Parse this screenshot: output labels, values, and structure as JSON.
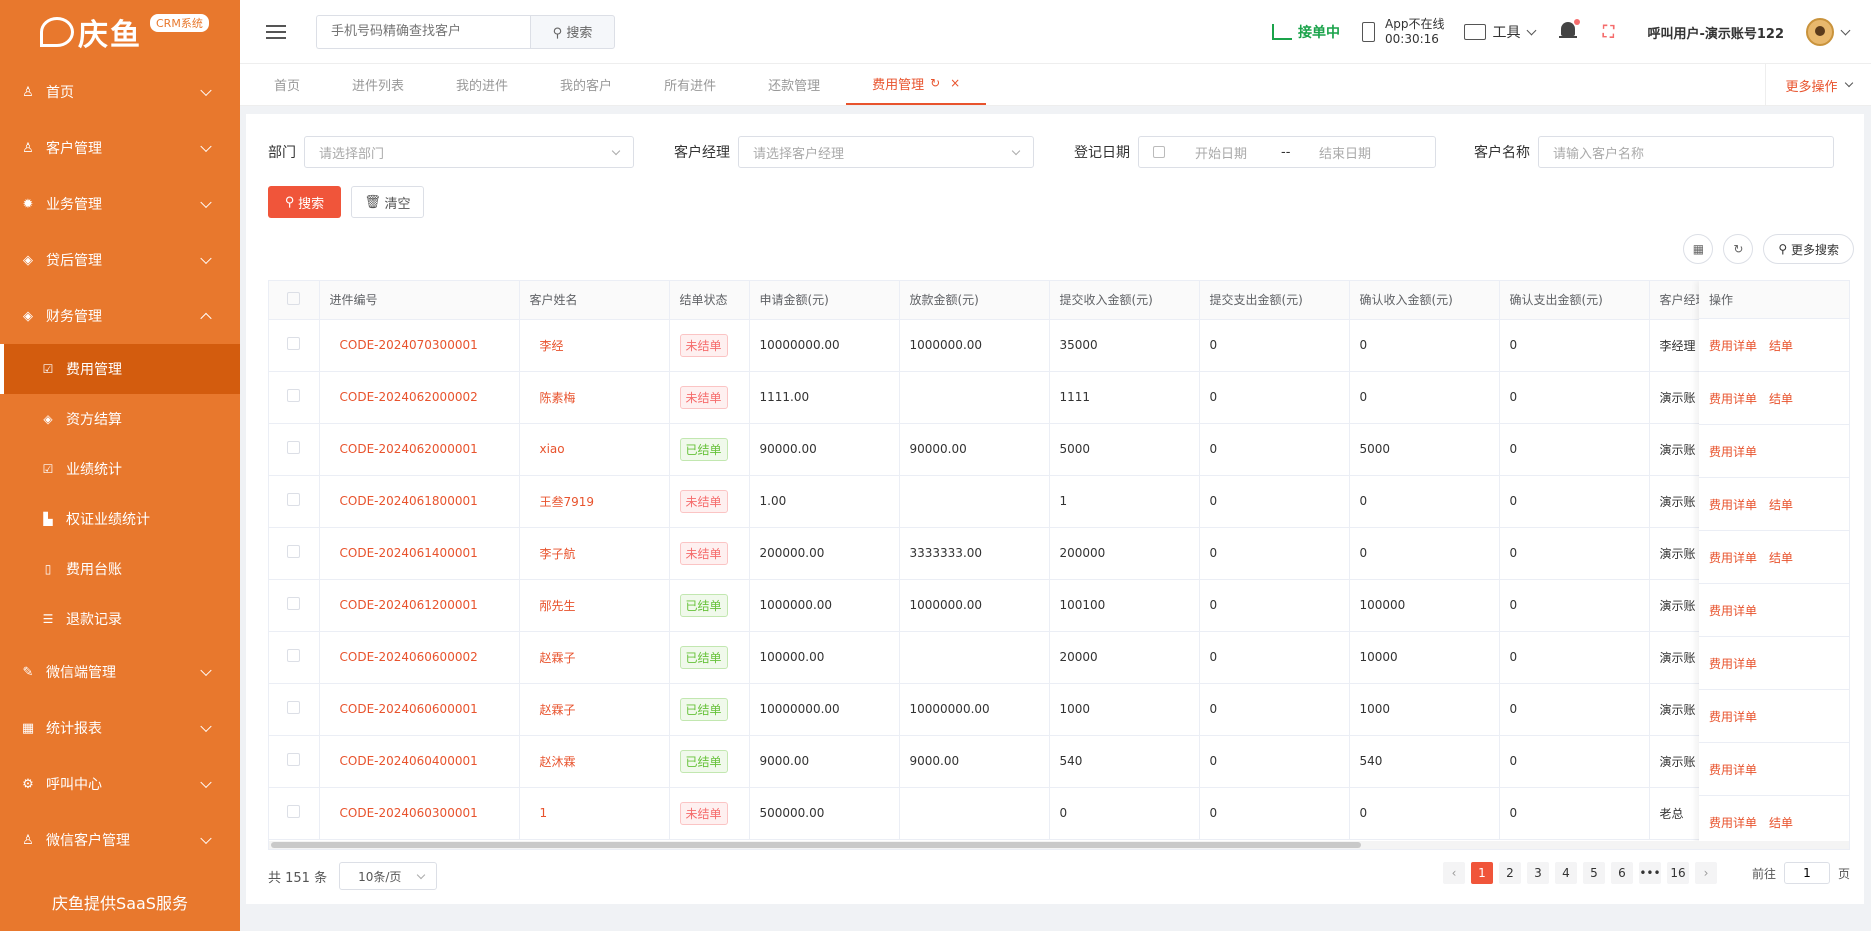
{
  "brand": {
    "name": "庆鱼",
    "badge": "CRM系统"
  },
  "sidebar": {
    "items": [
      {
        "label": "首页",
        "icon": "user-icon",
        "glyph": "♙"
      },
      {
        "label": "客户管理",
        "icon": "customer-icon",
        "glyph": "♙"
      },
      {
        "label": "业务管理",
        "icon": "bug-icon",
        "glyph": "✹"
      },
      {
        "label": "贷后管理",
        "icon": "tag-icon",
        "glyph": "◈"
      },
      {
        "label": "财务管理",
        "icon": "tag-icon",
        "glyph": "◈"
      }
    ],
    "sub_items": [
      {
        "label": "费用管理",
        "icon": "check-square-icon",
        "glyph": "☑"
      },
      {
        "label": "资方结算",
        "icon": "tag-icon",
        "glyph": "◈"
      },
      {
        "label": "业绩统计",
        "icon": "check-square-icon",
        "glyph": "☑"
      },
      {
        "label": "权证业绩统计",
        "icon": "bar-chart-icon",
        "glyph": "▙"
      },
      {
        "label": "费用台账",
        "icon": "book-icon",
        "glyph": "▯"
      },
      {
        "label": "退款记录",
        "icon": "list-icon",
        "glyph": "☰"
      }
    ],
    "items_after": [
      {
        "label": "微信端管理",
        "icon": "edit-icon",
        "glyph": "✎"
      },
      {
        "label": "统计报表",
        "icon": "table-icon",
        "glyph": "▦"
      },
      {
        "label": "呼叫中心",
        "icon": "settings-icon",
        "glyph": "⚙"
      },
      {
        "label": "微信客户管理",
        "icon": "customer-icon",
        "glyph": "♙"
      }
    ],
    "footer": "庆鱼提供SaaS服务"
  },
  "header": {
    "search_placeholder": "手机号码精确查找客户",
    "search_button": "搜索",
    "accept_label": "接单中",
    "app_status": "App不在线",
    "app_time": "00:30:16",
    "tools_label": "工具",
    "username": "呼叫用户-演示账号122"
  },
  "tabs": [
    {
      "label": "首页"
    },
    {
      "label": "进件列表"
    },
    {
      "label": "我的进件"
    },
    {
      "label": "我的客户"
    },
    {
      "label": "所有进件"
    },
    {
      "label": "还款管理"
    },
    {
      "label": "费用管理"
    }
  ],
  "more_ops": "更多操作",
  "filters": {
    "dept_label": "部门",
    "dept_placeholder": "请选择部门",
    "manager_label": "客户经理",
    "manager_placeholder": "请选择客户经理",
    "date_label": "登记日期",
    "date_start": "开始日期",
    "date_sep": "--",
    "date_end": "结束日期",
    "name_label": "客户名称",
    "name_placeholder": "请输入客户名称",
    "search_btn": "搜索",
    "clear_btn": "清空",
    "more_search": "更多搜索"
  },
  "table": {
    "columns": [
      "进件编号",
      "客户姓名",
      "结单状态",
      "申请金额(元)",
      "放款金额(元)",
      "提交收入金额(元)",
      "提交支出金额(元)",
      "确认收入金额(元)",
      "确认支出金额(元)",
      "客户经理",
      "操作"
    ],
    "rows": [
      {
        "code": "CODE-2024070300001",
        "name": "李经",
        "status": "未结单",
        "closed": false,
        "apply": "10000000.00",
        "loan": "1000000.00",
        "sub_in": "35000",
        "sub_out": "0",
        "conf_in": "0",
        "conf_out": "0",
        "manager": "李经理"
      },
      {
        "code": "CODE-2024062000002",
        "name": "陈素梅",
        "status": "未结单",
        "closed": false,
        "apply": "1111.00",
        "loan": "",
        "sub_in": "1111",
        "sub_out": "0",
        "conf_in": "0",
        "conf_out": "0",
        "manager": "演示账"
      },
      {
        "code": "CODE-2024062000001",
        "name": "xiao",
        "status": "已结单",
        "closed": true,
        "apply": "90000.00",
        "loan": "90000.00",
        "sub_in": "5000",
        "sub_out": "0",
        "conf_in": "5000",
        "conf_out": "0",
        "manager": "演示账"
      },
      {
        "code": "CODE-2024061800001",
        "name": "王叁7919",
        "status": "未结单",
        "closed": false,
        "apply": "1.00",
        "loan": "",
        "sub_in": "1",
        "sub_out": "0",
        "conf_in": "0",
        "conf_out": "0",
        "manager": "演示账"
      },
      {
        "code": "CODE-2024061400001",
        "name": "李子航",
        "status": "未结单",
        "closed": false,
        "apply": "200000.00",
        "loan": "3333333.00",
        "sub_in": "200000",
        "sub_out": "0",
        "conf_in": "0",
        "conf_out": "0",
        "manager": "演示账"
      },
      {
        "code": "CODE-2024061200001",
        "name": "邴先生",
        "status": "已结单",
        "closed": true,
        "apply": "1000000.00",
        "loan": "1000000.00",
        "sub_in": "100100",
        "sub_out": "0",
        "conf_in": "100000",
        "conf_out": "0",
        "manager": "演示账"
      },
      {
        "code": "CODE-2024060600002",
        "name": "赵霖子",
        "status": "已结单",
        "closed": true,
        "apply": "100000.00",
        "loan": "",
        "sub_in": "20000",
        "sub_out": "0",
        "conf_in": "10000",
        "conf_out": "0",
        "manager": "演示账"
      },
      {
        "code": "CODE-2024060600001",
        "name": "赵霖子",
        "status": "已结单",
        "closed": true,
        "apply": "10000000.00",
        "loan": "10000000.00",
        "sub_in": "1000",
        "sub_out": "0",
        "conf_in": "1000",
        "conf_out": "0",
        "manager": "演示账"
      },
      {
        "code": "CODE-2024060400001",
        "name": "赵沐霖",
        "status": "已结单",
        "closed": true,
        "apply": "9000.00",
        "loan": "9000.00",
        "sub_in": "540",
        "sub_out": "0",
        "conf_in": "540",
        "conf_out": "0",
        "manager": "演示账"
      },
      {
        "code": "CODE-2024060300001",
        "name": "1",
        "status": "未结单",
        "closed": false,
        "apply": "500000.00",
        "loan": "",
        "sub_in": "0",
        "sub_out": "0",
        "conf_in": "0",
        "conf_out": "0",
        "manager": "老总"
      }
    ],
    "op_detail": "费用详单",
    "op_close": "结单"
  },
  "pagination": {
    "total": "共 151 条",
    "page_size": "10条/页",
    "pages": [
      "1",
      "2",
      "3",
      "4",
      "5",
      "6",
      "•••",
      "16"
    ],
    "current": "1",
    "goto_label": "前往",
    "goto_value": "1",
    "goto_suffix": "页"
  },
  "colors": {
    "sidebar": "#e8782d",
    "accent": "#f0553a",
    "link": "#e8532d",
    "success": "#67c23a",
    "danger": "#f56c6c"
  }
}
